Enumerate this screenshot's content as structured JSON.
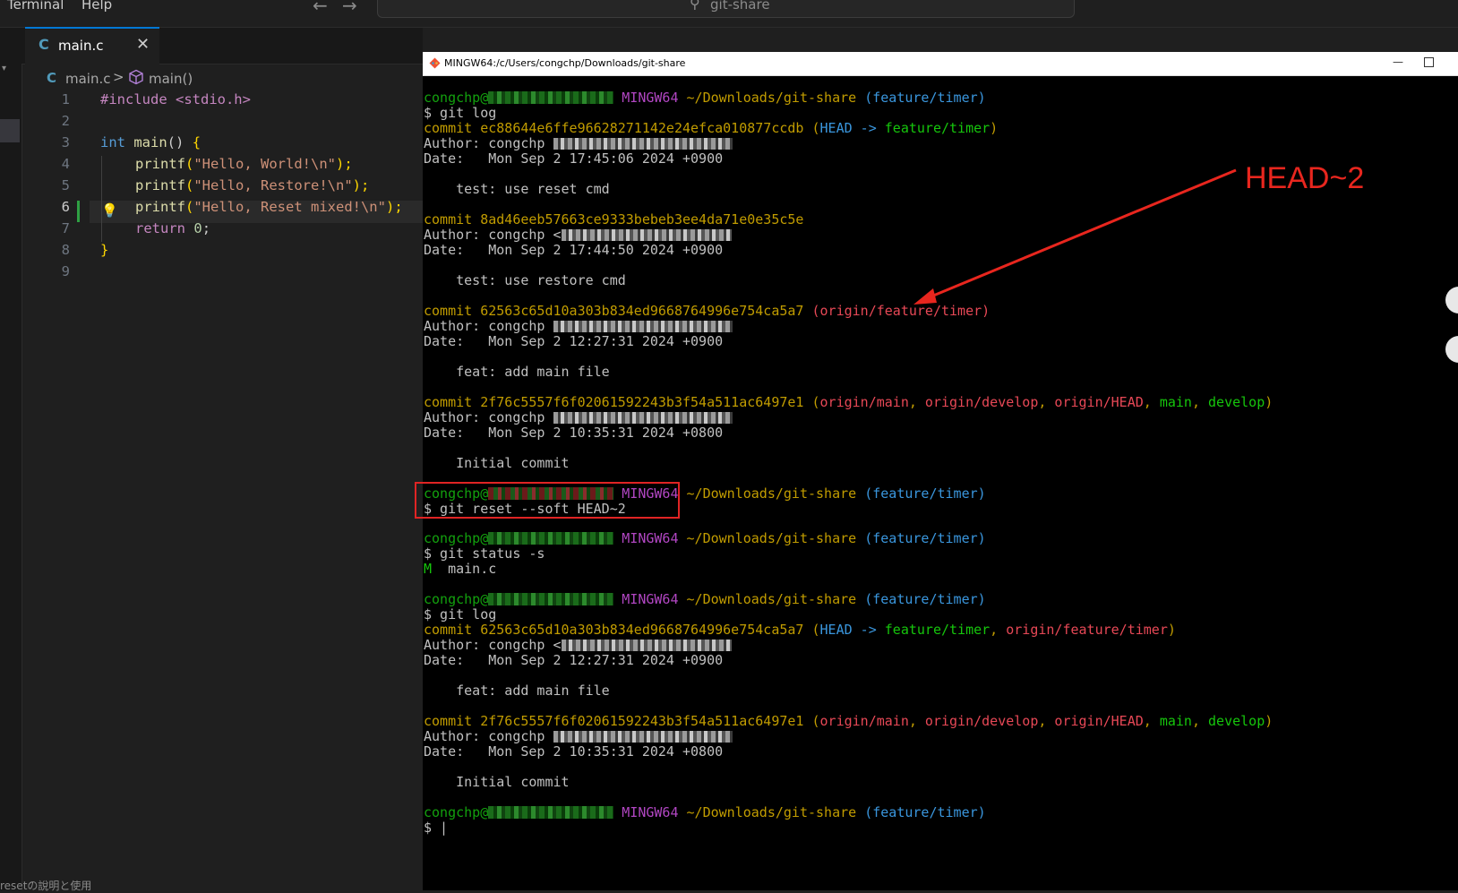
{
  "menu": [
    "Terminal",
    "Help"
  ],
  "search_text": "git-share",
  "tab_label": "main.c",
  "tab_icon_letter": "C",
  "breadcrumb": {
    "file": "main.c",
    "separator": ">",
    "symbol": "main()"
  },
  "editor": {
    "line_numbers": [
      "1",
      "2",
      "3",
      "4",
      "5",
      "6",
      "7",
      "8",
      "9"
    ],
    "current_line": "6",
    "lines": [
      {
        "pp": "#include <stdio.h>"
      },
      {},
      {
        "kw": "int",
        "fn": "main",
        "paren": "()",
        "brace": "{"
      },
      {
        "fn": "printf",
        "open": "(",
        "str": "\"Hello, World!\\n\"",
        "close": ");"
      },
      {
        "fn": "printf",
        "open": "(",
        "str": "\"Hello, Restore!\\n\"",
        "close": ");"
      },
      {
        "fn": "printf",
        "open": "(",
        "str": "\"Hello, Reset mixed!\\n\"",
        "close": ");"
      },
      {
        "kw": "return",
        "num": "0",
        "end": ";"
      },
      {
        "brace": "}"
      },
      {}
    ]
  },
  "terminal": {
    "title": "MINGW64:/c/Users/congchp/Downloads/git-share",
    "user": "congchp@",
    "env": "MINGW64",
    "path": "~/Downloads/git-share",
    "branch": "(feature/timer)",
    "cmd_log": "$ git log",
    "cmd_reset": "$ git reset --soft HEAD~2",
    "cmd_status": "$ git status -s",
    "status_flag": "M",
    "status_file": "  main.c",
    "prompt": "$ |",
    "commits1": [
      {
        "hash": "commit ec88644e6ffe96628271142e24efca010877ccdb",
        "refs_open": " (",
        "head": "HEAD",
        "arrow": " -> ",
        "local": "feature/timer",
        "refs_close": ")",
        "author": "Author: congchp ",
        "date": "Date:   Mon Sep 2 17:45:06 2024 +0900",
        "msg": "    test: use reset cmd"
      },
      {
        "hash": "commit 8ad46eeb57663ce9333bebeb3ee4da71e0e35c5e",
        "author": "Author: congchp <",
        "date": "Date:   Mon Sep 2 17:44:50 2024 +0900",
        "msg": "    test: use restore cmd"
      },
      {
        "hash": "commit 62563c65d10a303b834ed9668764996e754ca5a7",
        "remote": " (origin/feature/timer)",
        "author": "Author: congchp ",
        "date": "Date:   Mon Sep 2 12:27:31 2024 +0900",
        "msg": "    feat: add main file"
      },
      {
        "hash": "commit 2f76c5557f6f02061592243b3f54a511ac6497e1",
        "author": "Author: congchp ",
        "date": "Date:   Mon Sep 2 10:35:31 2024 +0800",
        "msg": "    Initial commit"
      }
    ],
    "commits2": [
      {
        "hash": "commit 62563c65d10a303b834ed9668764996e754ca5a7",
        "author": "Author: congchp <",
        "date": "Date:   Mon Sep 2 12:27:31 2024 +0900",
        "msg": "    feat: add main file"
      },
      {
        "hash": "commit 2f76c5557f6f02061592243b3f54a511ac6497e1",
        "author": "Author: congchp ",
        "date": "Date:   Mon Sep 2 10:35:31 2024 +0800",
        "msg": "    Initial commit"
      }
    ],
    "refs_initial": {
      "open": " (",
      "origin_main": "origin/main",
      "comma": ", ",
      "origin_develop": "origin/develop",
      "origin_head": "origin/HEAD",
      "main": "main",
      "develop": "develop",
      "close": ")"
    },
    "refs_head2": {
      "open": " (",
      "head": "HEAD",
      "arrow": " -> ",
      "local": "feature/timer",
      "comma": ", ",
      "remote": "origin/feature/timer",
      "close": ")"
    }
  },
  "annotation": "HEAD~2",
  "bottom_text": "resetの說明と使用",
  "colors": {
    "accent": "#0078d4",
    "annotation": "#e8261e",
    "terminal_bg": "#000000"
  }
}
